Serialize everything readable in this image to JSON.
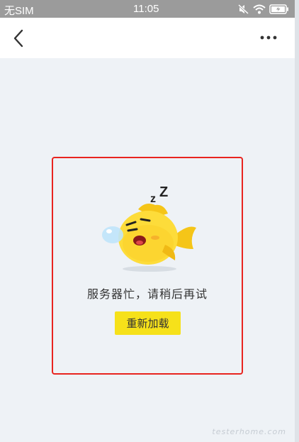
{
  "status_bar": {
    "carrier": "无SIM",
    "time": "11:05",
    "icons": [
      "mute-icon",
      "wifi-icon",
      "battery-charging-icon"
    ]
  },
  "nav": {
    "back_icon": "chevron-left-icon",
    "more_icon": "more-horizontal-icon"
  },
  "error_state": {
    "message": "服务器忙，请稍后再试",
    "button_label": "重新加载",
    "highlight_color": "#e8241f",
    "button_color": "#f6e11a",
    "mascot": "sleeping-yellow-fish-illustration"
  },
  "watermark": "testerhome.com"
}
